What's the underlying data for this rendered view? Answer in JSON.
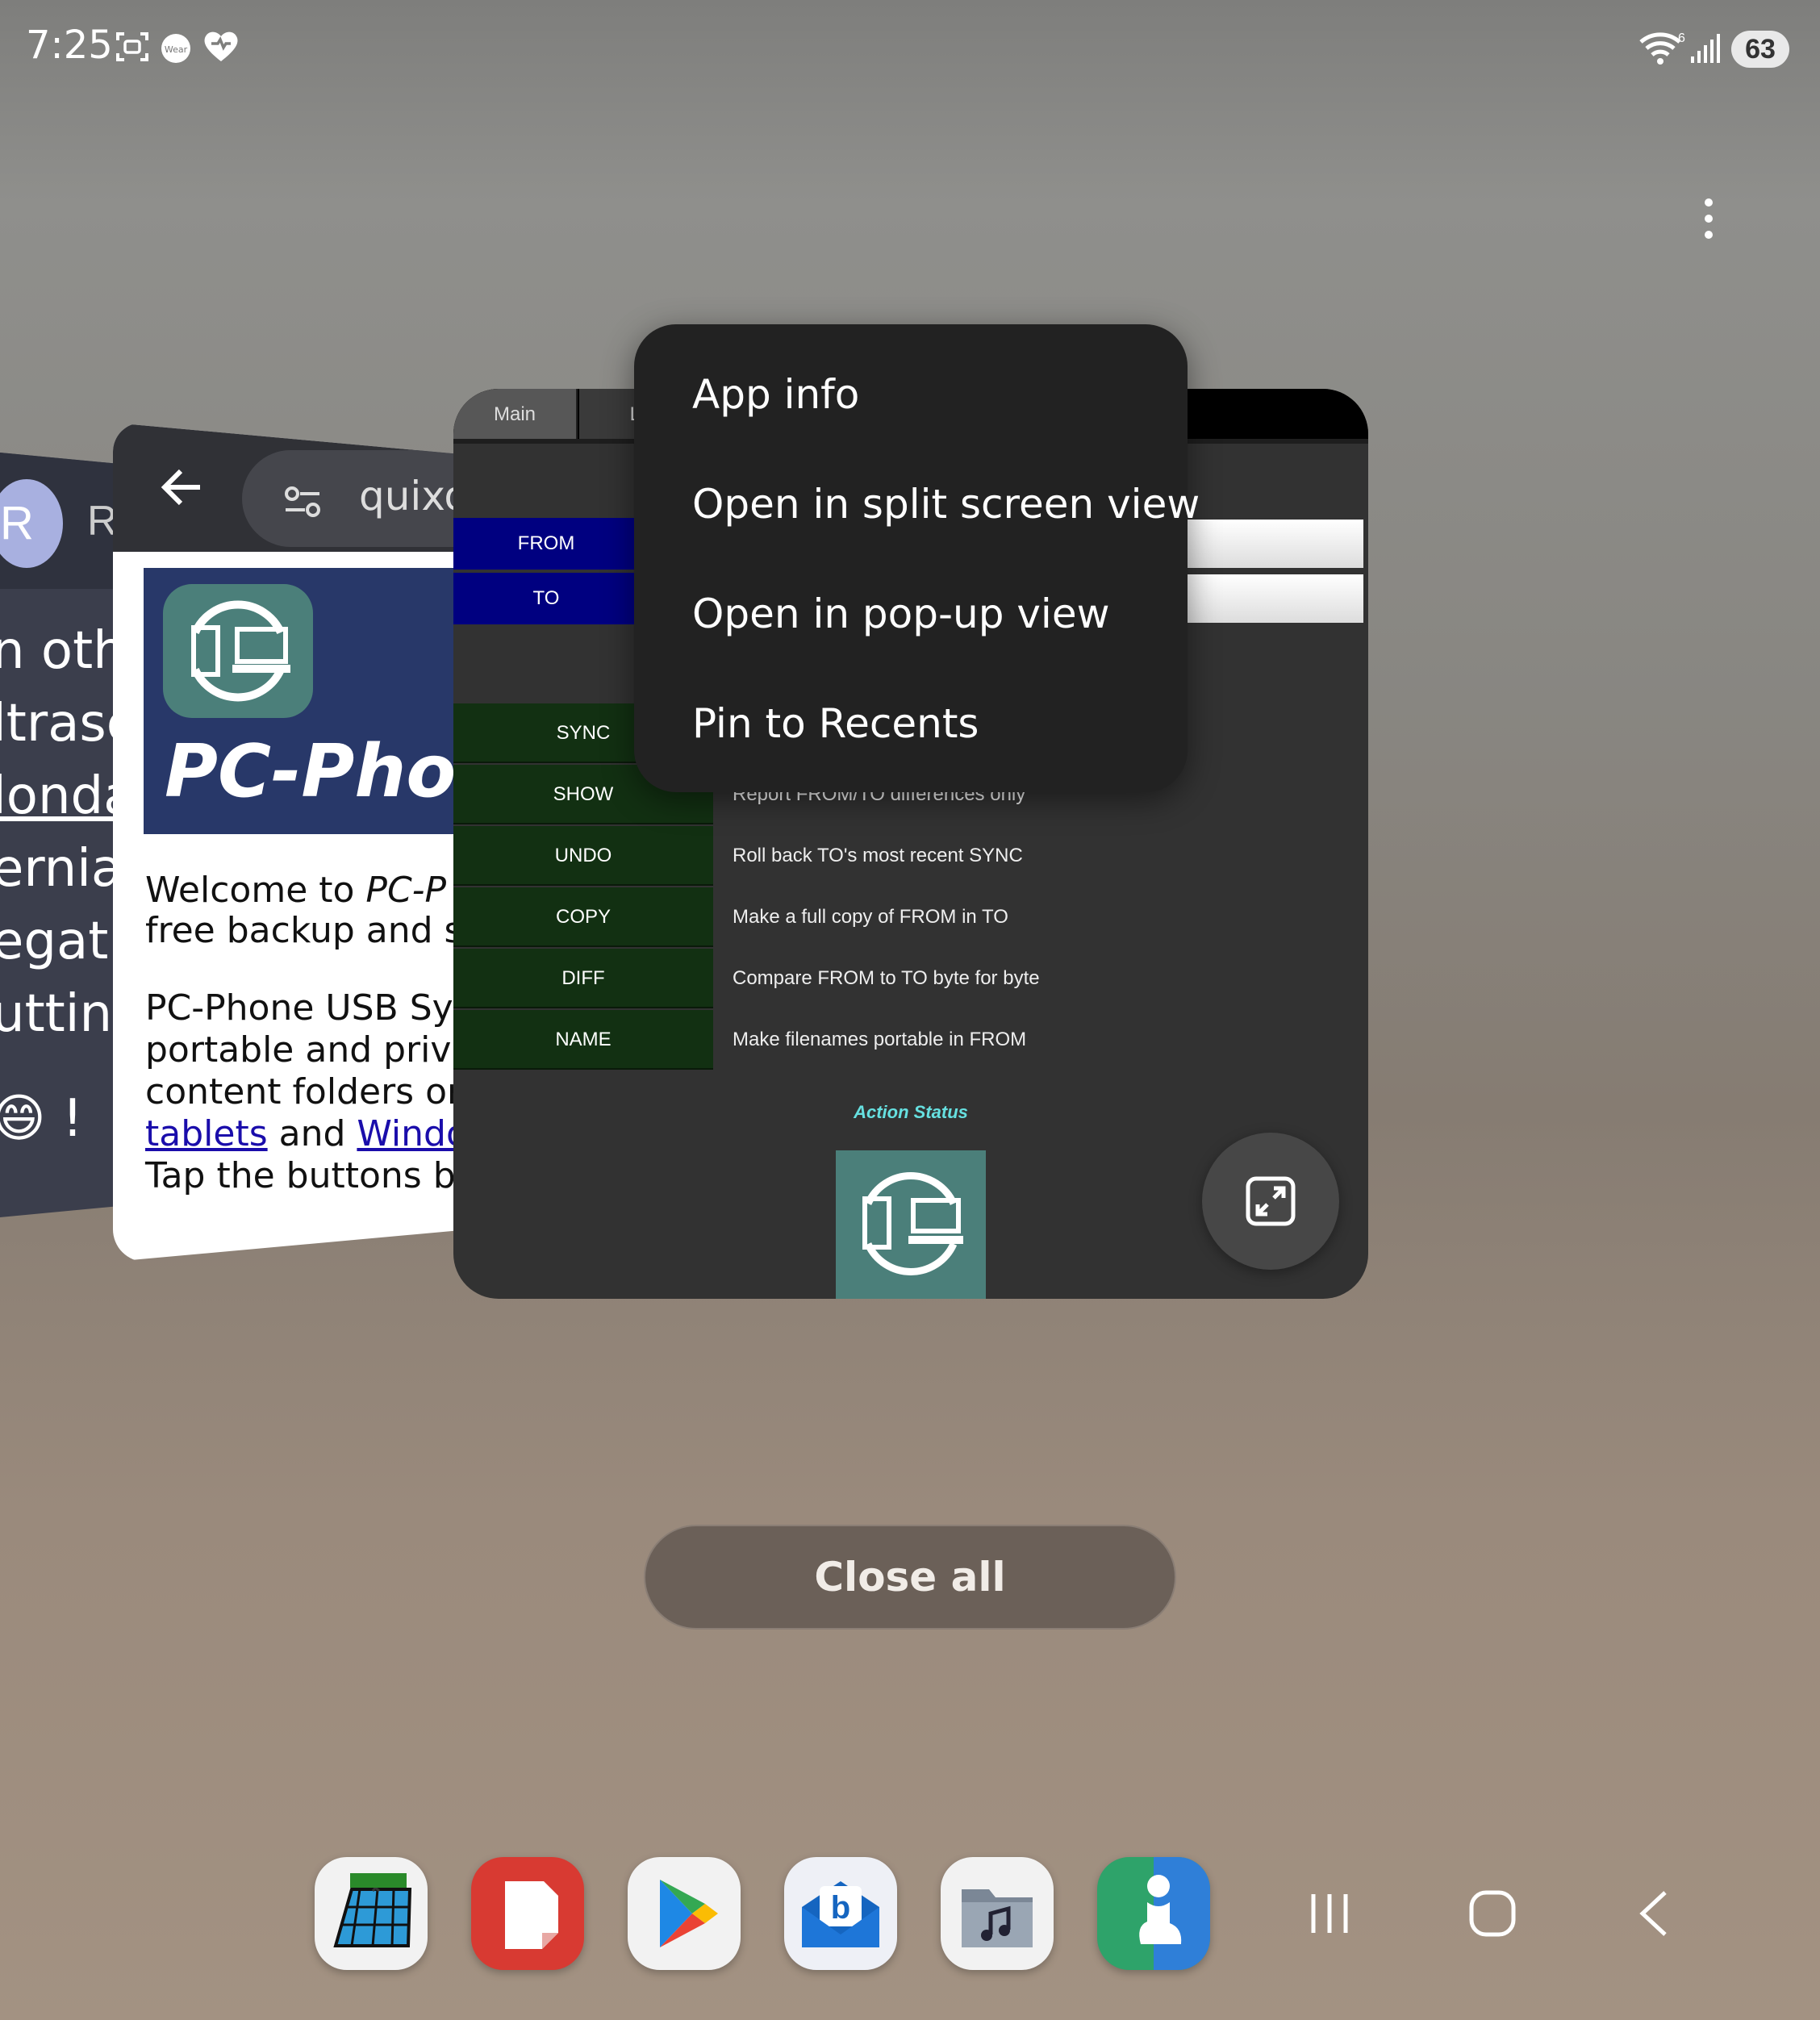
{
  "status_bar": {
    "time": "7:25",
    "battery": "63",
    "icons": [
      "screenshot-icon",
      "wear-icon",
      "health-icon",
      "wifi-icon",
      "signal-icon"
    ]
  },
  "recents": {
    "card_left": {
      "avatar": "R",
      "avatar_next": "R",
      "lines": [
        "n othe",
        "ltrasc",
        "londa",
        "ernia",
        "egati",
        "utting",
        "😄 !"
      ]
    },
    "card_browser": {
      "omnibox": "quixo",
      "banner_brand": "PC-Phon",
      "welcome_1": "Welcome to ",
      "welcome_1_italic": "PC-P",
      "welcome_2": "free backup and s",
      "para_1": "PC-Phone USB Sy",
      "para_2": "portable and priva",
      "para_3": "content folders or",
      "link_tablets": "tablets",
      "and": " and ",
      "link_windows": "Windo",
      "para_5": "Tap the buttons b"
    },
    "card_app": {
      "tabs": [
        "Main",
        "Lo"
      ],
      "from_label": "FROM",
      "to_label": "TO",
      "actions": [
        {
          "label": "SYNC",
          "desc": ""
        },
        {
          "label": "SHOW",
          "desc": "Report FROM/TO differences only"
        },
        {
          "label": "UNDO",
          "desc": "Roll back TO's most recent SYNC"
        },
        {
          "label": "COPY",
          "desc": "Make a full copy of FROM in TO"
        },
        {
          "label": "DIFF",
          "desc": "Compare FROM to TO byte for byte"
        },
        {
          "label": "NAME",
          "desc": "Make filenames portable in FROM"
        }
      ],
      "status_title": "Action Status"
    }
  },
  "context_menu": {
    "items": [
      "App info",
      "Open in split screen view",
      "Open in pop-up view",
      "Pin to Recents"
    ]
  },
  "close_all_label": "Close all",
  "dock": {
    "apps": [
      "calendar-app-icon",
      "notes-app-icon",
      "play-store-icon",
      "mail-app-icon",
      "music-files-icon",
      "accessibility-app-icon"
    ]
  },
  "colors": {
    "menu_bg": "#222222",
    "app_from_to": "#000080",
    "app_action": "#123012",
    "status_title": "#66e0e0"
  }
}
